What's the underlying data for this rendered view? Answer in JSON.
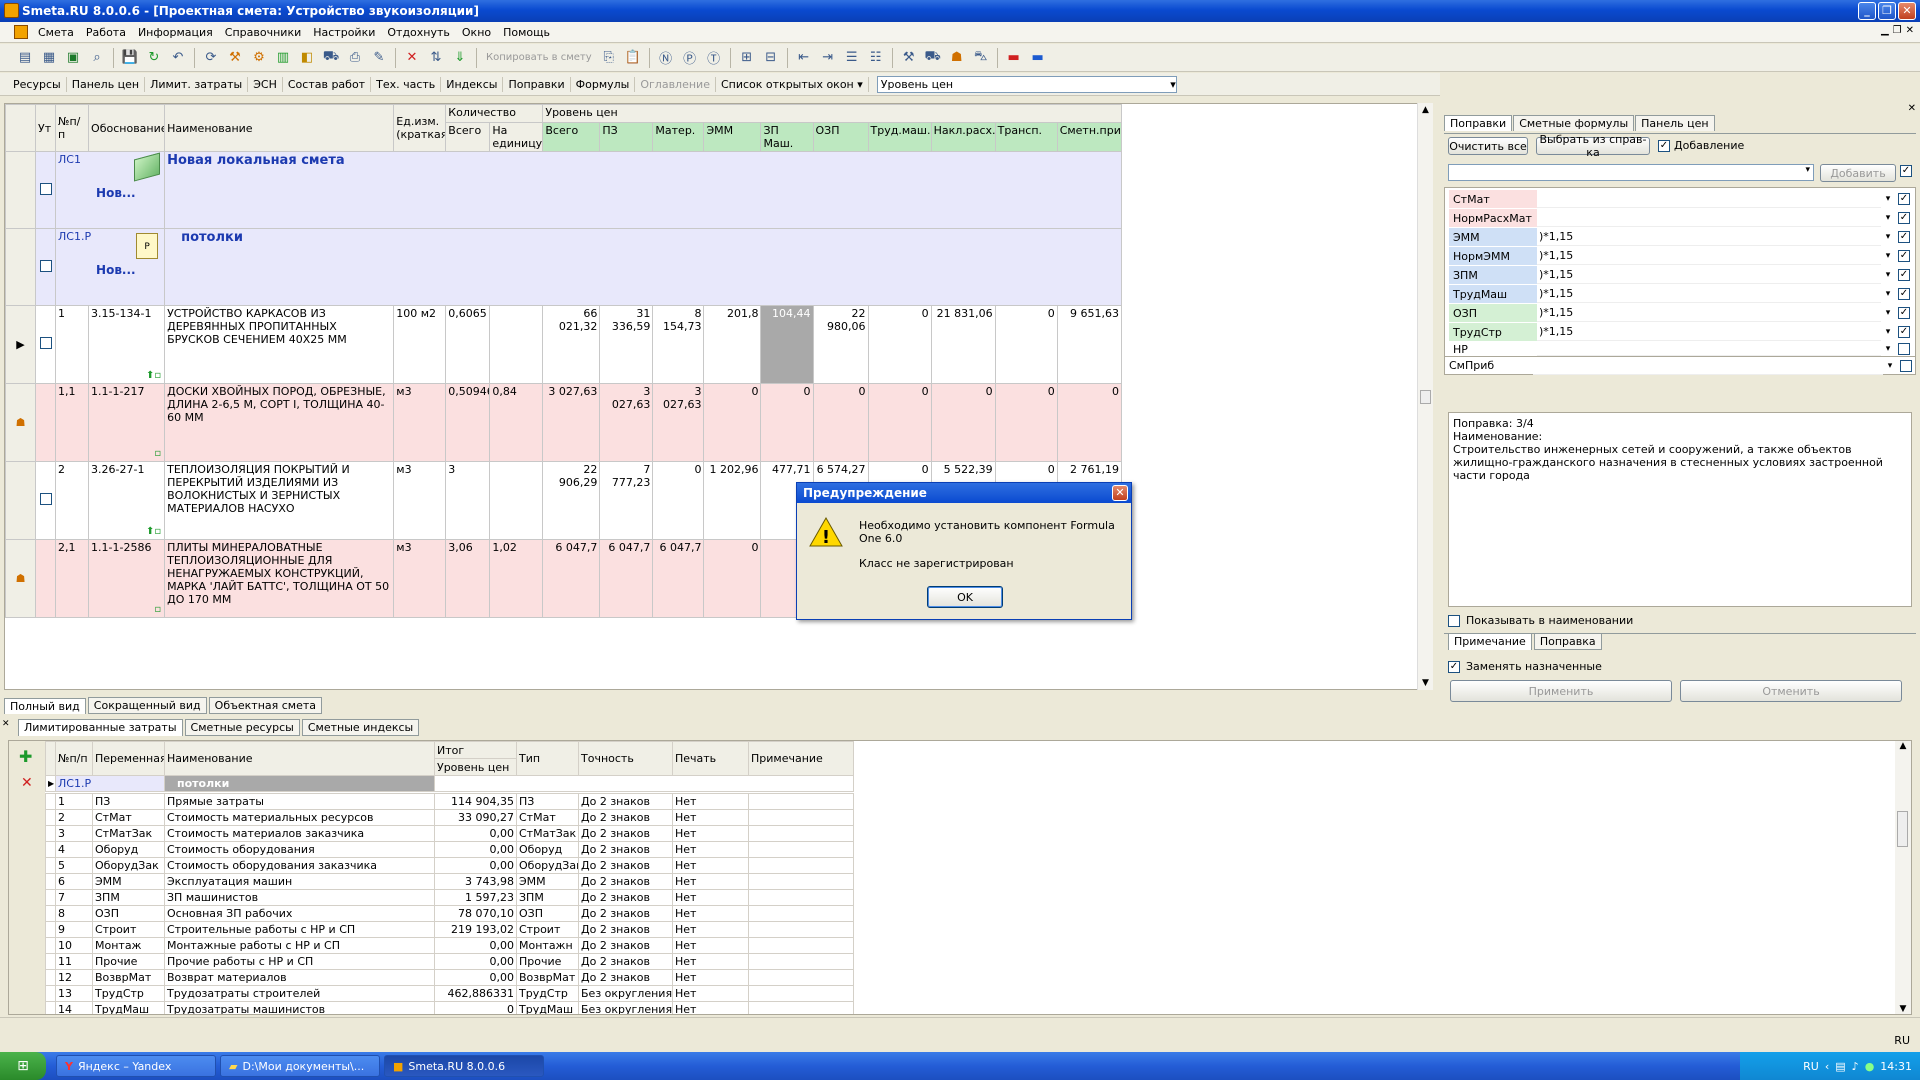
{
  "window": {
    "title": "Smeta.RU  8.0.0.6  - [Проектная смета: Устройство звукоизоляции]"
  },
  "menu": [
    "Смета",
    "Работа",
    "Информация",
    "Справочники",
    "Настройки",
    "Отдохнуть",
    "Окно",
    "Помощь"
  ],
  "toolbar": {
    "copy_to_estimate": "Копировать в смету"
  },
  "tabs_top": [
    "Ресурсы",
    "Панель цен",
    "Лимит. затраты",
    "ЭСН",
    "Состав работ",
    "Тех. часть",
    "Индексы",
    "Поправки",
    "Формулы",
    "Оглавление",
    "Список открытых окон ▾"
  ],
  "price_level": "Уровень цен",
  "grid": {
    "headers": {
      "ut": "Ут",
      "npp": "№п/п",
      "basis": "Обоснование",
      "name": "Наименование",
      "unit": "Ед.изм. (краткая)",
      "qty": "Количество",
      "qty_total": "Всего",
      "qty_per": "На единицу",
      "price_level": "Уровень цен",
      "total": "Всего",
      "pz": "ПЗ",
      "mater": "Матер.",
      "emm": "ЭММ",
      "zpmash": "ЗП Маш.",
      "ozp": "ОЗП",
      "trudmash": "Труд.маш.",
      "naklrash": "Накл.расх.",
      "transp": "Трансп.",
      "smetnprib": "Сметн.приб"
    },
    "sections": [
      {
        "code": "ЛС1",
        "title": "Новая локальная смета",
        "sub": "Нов..."
      },
      {
        "code": "ЛС1.Р",
        "title": "потолки",
        "sub": "Нов..."
      }
    ],
    "rows": [
      {
        "npp": "1",
        "basis": "3.15-134-1",
        "name": "УСТРОЙСТВО КАРКАСОВ ИЗ ДЕРЕВЯННЫХ ПРОПИТАННЫХ БРУСКОВ СЕЧЕНИЕМ 40Х25 ММ",
        "unit": "100 м2",
        "qty": "0,6065",
        "per": "",
        "total": "66 021,32",
        "pz": "31 336,59",
        "mater": "8 154,73",
        "emm": "201,8",
        "zpmash": "104,44",
        "ozp": "22 980,06",
        "trudmash": "0",
        "nakl": "21 831,06",
        "transp": "0",
        "prib": "9 651,63",
        "style": "white"
      },
      {
        "npp": "1,1",
        "basis": "1.1-1-217",
        "name": "ДОСКИ ХВОЙНЫХ ПОРОД, ОБРЕЗНЫЕ, ДЛИНА 2-6,5 М, СОРТ I, ТОЛЩИНА 40-60 ММ",
        "unit": "м3",
        "qty": "0,50946",
        "per": "0,84",
        "total": "3 027,63",
        "pz": "3 027,63",
        "mater": "3 027,63",
        "emm": "0",
        "zpmash": "0",
        "ozp": "0",
        "trudmash": "0",
        "nakl": "0",
        "transp": "0",
        "prib": "0",
        "style": "pink"
      },
      {
        "npp": "2",
        "basis": "3.26-27-1",
        "name": "ТЕПЛОИЗОЛЯЦИЯ ПОКРЫТИЙ И ПЕРЕКРЫТИЙ ИЗДЕЛИЯМИ ИЗ ВОЛОКНИСТЫХ И ЗЕРНИСТЫХ МАТЕРИАЛОВ НАСУХО",
        "unit": "м3",
        "qty": "3",
        "per": "",
        "total": "22 906,29",
        "pz": "7 777,23",
        "mater": "0",
        "emm": "1 202,96",
        "zpmash": "477,71",
        "ozp": "6 574,27",
        "trudmash": "0",
        "nakl": "5 522,39",
        "transp": "0",
        "prib": "2 761,19",
        "style": "white"
      },
      {
        "npp": "2,1",
        "basis": "1.1-1-2586",
        "name": "ПЛИТЫ МИНЕРАЛОВАТНЫЕ ТЕПЛОИЗОЛЯЦИОННЫЕ ДЛЯ НЕНАГРУЖАЕМЫХ КОНСТРУКЦИЙ, МАРКА 'ЛАЙТ БАТТС', ТОЛЩИНА ОТ 50 ДО 170 ММ",
        "unit": "м3",
        "qty": "3,06",
        "per": "1,02",
        "total": "6 047,7",
        "pz": "6 047,7",
        "mater": "6 047,7",
        "emm": "0",
        "zpmash": "",
        "ozp": "",
        "trudmash": "",
        "nakl": "",
        "transp": "",
        "prib": "",
        "style": "pink"
      }
    ]
  },
  "view_tabs": [
    "Полный вид",
    "Сокращенный вид",
    "Объектная смета"
  ],
  "right_panel": {
    "tabs": [
      "Поправки",
      "Сметные формулы",
      "Панель цен"
    ],
    "clear_all": "Очистить все",
    "choose_ref": "Выбрать из справ-ка",
    "add_check": "Добавление",
    "add_button": "Добавить",
    "params": [
      {
        "name": "СтМат",
        "value": "",
        "color": "#fbe0e0",
        "checked": true
      },
      {
        "name": "НормРасхМат",
        "value": "",
        "color": "#fbe0e0",
        "checked": true
      },
      {
        "name": "ЭММ",
        "value": ")*1,15",
        "color": "#cfe0f6",
        "checked": true
      },
      {
        "name": "НормЭММ",
        "value": ")*1,15",
        "color": "#cfe0f6",
        "checked": true
      },
      {
        "name": "ЗПМ",
        "value": ")*1,15",
        "color": "#cfe0f6",
        "checked": true
      },
      {
        "name": "ТрудМаш",
        "value": ")*1,15",
        "color": "#cfe0f6",
        "checked": true
      },
      {
        "name": "ОЗП",
        "value": ")*1,15",
        "color": "#d4f0d4",
        "checked": true
      },
      {
        "name": "ТрудСтр",
        "value": ")*1,15",
        "color": "#d4f0d4",
        "checked": true
      },
      {
        "name": "НР",
        "value": "",
        "color": "#ffffff",
        "checked": false
      },
      {
        "name": "СмПриб",
        "value": "",
        "color": "#ffffff",
        "checked": false
      }
    ],
    "note_line1": "Поправка: 3/4",
    "note_line2": "Наименование:",
    "note_line3": "Строительство инженерных сетей и сооружений, а также объектов",
    "note_line4": "жилищно-гражданского назначения в стесненных условиях застроенной части города",
    "show_in_name": "Показывать в наименовании",
    "subtab_note": "Примечание",
    "subtab_correction": "Поправка",
    "replace_assigned": "Заменять назначенные",
    "apply": "Применить",
    "cancel": "Отменить"
  },
  "lower": {
    "tabs": [
      "Лимитированные затраты",
      "Сметные ресурсы",
      "Сметные индексы"
    ],
    "headers": {
      "npp": "№п/п",
      "var": "Переменная",
      "name": "Наименование",
      "itog": "Итог",
      "level": "Уровень цен",
      "type": "Тип",
      "precision": "Точность",
      "print": "Печать",
      "note": "Примечание"
    },
    "section": {
      "code": "ЛС1.Р",
      "name": "потолки"
    },
    "rows": [
      {
        "n": "1",
        "var": "ПЗ",
        "name": "Прямые затраты",
        "val": "114 904,35",
        "type": "ПЗ",
        "prec": "До 2 знаков",
        "print": "Нет"
      },
      {
        "n": "2",
        "var": "СтМат",
        "name": "Стоимость материальных ресурсов",
        "val": "33 090,27",
        "type": "СтМат",
        "prec": "До 2 знаков",
        "print": "Нет"
      },
      {
        "n": "3",
        "var": "СтМатЗак",
        "name": "Стоимость материалов заказчика",
        "val": "0,00",
        "type": "СтМатЗак",
        "prec": "До 2 знаков",
        "print": "Нет"
      },
      {
        "n": "4",
        "var": "Оборуд",
        "name": "Стоимость оборудования",
        "val": "0,00",
        "type": "Оборуд",
        "prec": "До 2 знаков",
        "print": "Нет"
      },
      {
        "n": "5",
        "var": "ОборудЗак",
        "name": "Стоимость оборудования заказчика",
        "val": "0,00",
        "type": "ОборудЗак",
        "prec": "До 2 знаков",
        "print": "Нет"
      },
      {
        "n": "6",
        "var": "ЭММ",
        "name": "Эксплуатация машин",
        "val": "3 743,98",
        "type": "ЭММ",
        "prec": "До 2 знаков",
        "print": "Нет"
      },
      {
        "n": "7",
        "var": "ЗПМ",
        "name": "ЗП машинистов",
        "val": "1 597,23",
        "type": "ЗПМ",
        "prec": "До 2 знаков",
        "print": "Нет"
      },
      {
        "n": "8",
        "var": "ОЗП",
        "name": "Основная ЗП рабочих",
        "val": "78 070,10",
        "type": "ОЗП",
        "prec": "До 2 знаков",
        "print": "Нет"
      },
      {
        "n": "9",
        "var": "Строит",
        "name": "Строительные работы с НР и СП",
        "val": "219 193,02",
        "type": "Строит",
        "prec": "До 2 знаков",
        "print": "Нет"
      },
      {
        "n": "10",
        "var": "Монтаж",
        "name": "Монтажные работы с НР и СП",
        "val": "0,00",
        "type": "Монтажн",
        "prec": "До 2 знаков",
        "print": "Нет"
      },
      {
        "n": "11",
        "var": "Прочие",
        "name": "Прочие работы с НР и СП",
        "val": "0,00",
        "type": "Прочие",
        "prec": "До 2 знаков",
        "print": "Нет"
      },
      {
        "n": "12",
        "var": "ВозврМат",
        "name": "Возврат материалов",
        "val": "0,00",
        "type": "ВозврМат",
        "prec": "До 2 знаков",
        "print": "Нет"
      },
      {
        "n": "13",
        "var": "ТрудСтр",
        "name": "Трудозатраты строителей",
        "val": "462,886331",
        "type": "ТрудСтр",
        "prec": "Без округления",
        "print": "Нет"
      },
      {
        "n": "14",
        "var": "ТрудМаш",
        "name": "Трудозатраты машинистов",
        "val": "0",
        "type": "ТрудМаш",
        "prec": "Без округления",
        "print": "Нет"
      }
    ]
  },
  "dialog": {
    "title": "Предупреждение",
    "line1": "Необходимо установить компонент Formula One 6.0",
    "line2": "Класс не зарегистрирован",
    "ok": "OK"
  },
  "status": {
    "lang": "RU"
  },
  "taskbar": {
    "tasks": [
      "Яндекс – Yandex",
      "D:\\Мои документы\\...",
      "Smeta.RU  8.0.0.6"
    ],
    "lang": "RU",
    "time": "14:31"
  }
}
